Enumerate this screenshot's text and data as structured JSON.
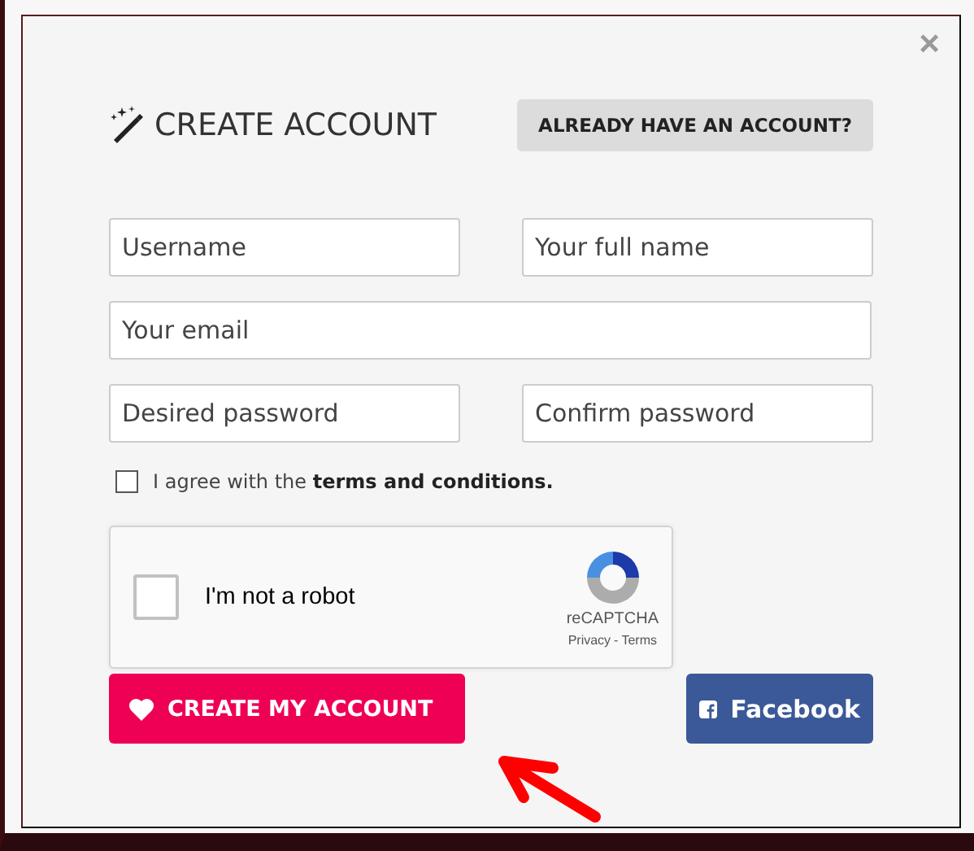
{
  "dialog": {
    "title": "CREATE ACCOUNT",
    "login_button": "ALREADY HAVE AN ACCOUNT?",
    "close": "×"
  },
  "fields": [
    {
      "kind": "half",
      "placeholder": "Username"
    },
    {
      "kind": "half",
      "placeholder": "Your full name"
    },
    {
      "kind": "full",
      "placeholder": "Your email"
    },
    {
      "kind": "half",
      "placeholder": "Desired password"
    },
    {
      "kind": "half",
      "placeholder": "Confirm password"
    }
  ],
  "terms": {
    "text": "I agree with the **terms and conditions.**",
    "checked": false
  },
  "captcha": {
    "label": "I'm not a robot",
    "checked": false,
    "brand": "reCAPTCHA",
    "privacy": "Privacy",
    "separator": "-",
    "terms": "Terms"
  },
  "buttons": {
    "create": "CREATE MY ACCOUNT",
    "facebook": "Facebook"
  }
}
